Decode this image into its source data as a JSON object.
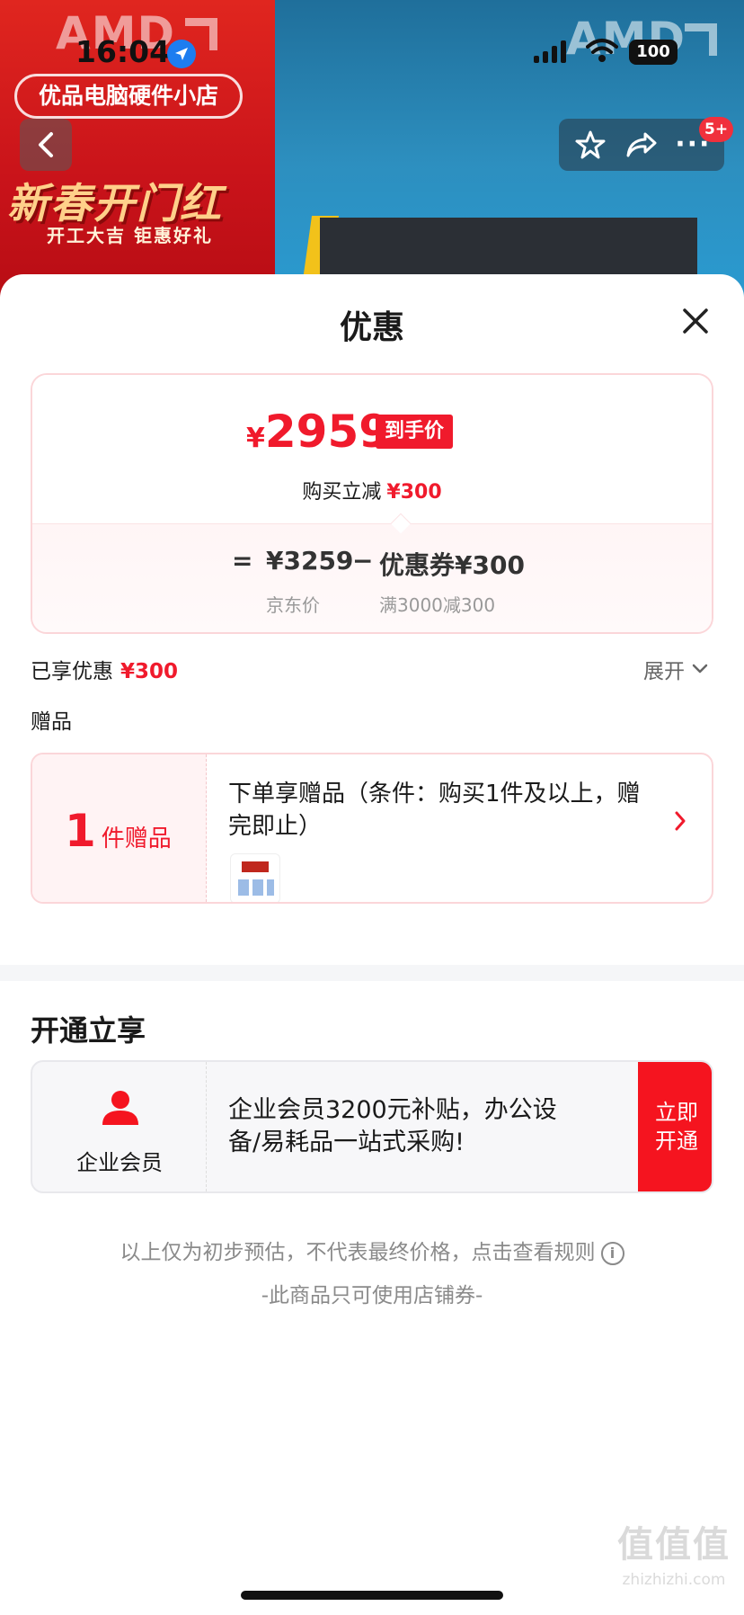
{
  "status_bar": {
    "time": "16:04",
    "battery": "100"
  },
  "background": {
    "brand_left": "AMD",
    "brand_right": "AMD",
    "shop_name": "优品电脑硬件小店",
    "promo_title": "新春开门红",
    "promo_sub": "开工大吉 钜惠好礼"
  },
  "nav": {
    "notification_badge": "5+"
  },
  "sheet": {
    "title": "优惠",
    "price": {
      "currency": "¥",
      "final_price": "2959",
      "final_tag": "到手价",
      "reduce_label": "购买立减",
      "reduce_amount": "¥300",
      "eq": "=",
      "jd_price": "¥3259",
      "jd_price_label": "京东价",
      "minus": "−",
      "coupon": "优惠券¥300",
      "coupon_label": "满3000减300"
    },
    "enjoyed_label": "已享优惠",
    "enjoyed_amount": "¥300",
    "expand_label": "展开",
    "gift_label": "赠品",
    "gift": {
      "count": "1",
      "count_unit": "件赠品",
      "description": "下单享赠品（条件：购买1件及以上，赠完即止）"
    },
    "open_title": "开通立享",
    "member": {
      "name": "企业会员",
      "description": "企业会员3200元补贴，办公设备/易耗品一站式采购!",
      "button_line1": "立即",
      "button_line2": "开通"
    },
    "note": "以上仅为初步预估，不代表最终价格，点击查看规则",
    "note2": "-此商品只可使用店铺券-"
  },
  "watermark": {
    "main": "值值值",
    "sub": "zhizhizhi.com"
  },
  "colors": {
    "accent": "#f01a2c",
    "member_button": "#f5141f"
  }
}
